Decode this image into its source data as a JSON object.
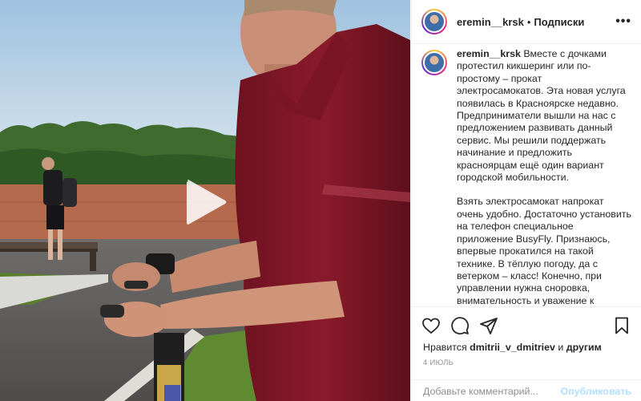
{
  "post": {
    "username": "eremin__krsk",
    "separator": "•",
    "follow_label": "Подписки",
    "more_label": "•••",
    "caption_paragraphs": [
      "Вместе с дочками протестил кикшеринг или по-простому – прокат электросамокатов. Эта новая услуга появилась в Красноярске недавно. Предприниматели вышли на нас с предложением развивать данный сервис. Мы решили поддержать начинание и предложить красноярцам ещё один вариант городской мобильности.",
      "Взять электросамокат напрокат очень удобно. Достаточно установить на телефон специальное приложение BusyFly. Признаюсь, впервые прокатился на такой технике. В тёплую погоду, да с ветерком – класс! Конечно, при управлении нужна сноровка, внимательность и уважение к"
    ],
    "likes_prefix": "Нравится",
    "likes_user": "dmitrii_v_dmitriev",
    "likes_middle": "и",
    "likes_others": "другим",
    "date": "4 ИЮЛЬ",
    "comment_placeholder": "Добавьте комментарий...",
    "publish_label": "Опубликовать"
  },
  "icons": {
    "like": "heart-icon",
    "comment": "comment-bubble-icon",
    "share": "paper-plane-icon",
    "save": "bookmark-icon",
    "play": "play-icon"
  },
  "colors": {
    "text": "#262626",
    "secondary": "#8e8e8e",
    "publish_disabled": "#b2dffc",
    "border": "#efefef"
  }
}
